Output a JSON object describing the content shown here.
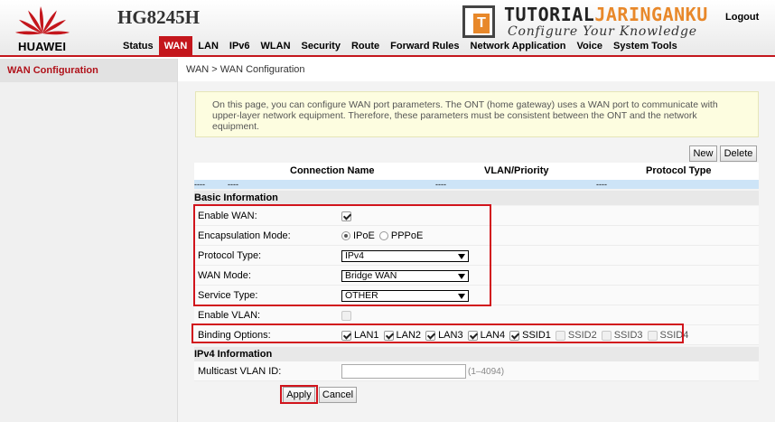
{
  "header": {
    "brand": "HUAWEI",
    "model": "HG8245H",
    "logout": "Logout",
    "watermark_title_a": "TUTORIAL",
    "watermark_title_b": "JARINGANKU",
    "watermark_sub": "Configure Your Knowledge",
    "brand_color": "#c4161c",
    "accent_color": "#e8882a"
  },
  "nav": {
    "items": [
      "Status",
      "WAN",
      "LAN",
      "IPv6",
      "WLAN",
      "Security",
      "Route",
      "Forward Rules",
      "Network Application",
      "Voice",
      "System Tools"
    ],
    "active": "WAN"
  },
  "sidebar": {
    "items": [
      "WAN Configuration"
    ]
  },
  "breadcrumb": "WAN > WAN Configuration",
  "notice": "On this page, you can configure WAN port parameters. The ONT (home gateway) uses a WAN port to communicate with upper-layer network equipment. Therefore, these parameters must be consistent between the ONT and the network equipment.",
  "toolbar": {
    "new_label": "New",
    "delete_label": "Delete"
  },
  "table": {
    "columns": [
      "Connection Name",
      "VLAN/Priority",
      "Protocol Type"
    ],
    "row": [
      "----",
      "----",
      "----",
      "----"
    ]
  },
  "basic": {
    "title": "Basic Information",
    "enable_wan_label": "Enable WAN:",
    "enable_wan": true,
    "encap_label": "Encapsulation Mode:",
    "encap_options": [
      "IPoE",
      "PPPoE"
    ],
    "encap_selected": "IPoE",
    "protocol_label": "Protocol Type:",
    "protocol_value": "IPv4",
    "wan_mode_label": "WAN Mode:",
    "wan_mode_value": "Bridge WAN",
    "service_label": "Service Type:",
    "service_value": "OTHER",
    "enable_vlan_label": "Enable VLAN:",
    "enable_vlan": false,
    "binding_label": "Binding Options:",
    "binding": [
      {
        "label": "LAN1",
        "checked": true
      },
      {
        "label": "LAN2",
        "checked": true
      },
      {
        "label": "LAN3",
        "checked": true
      },
      {
        "label": "LAN4",
        "checked": true
      },
      {
        "label": "SSID1",
        "checked": true
      },
      {
        "label": "SSID2",
        "checked": false
      },
      {
        "label": "SSID3",
        "checked": false
      },
      {
        "label": "SSID4",
        "checked": false
      }
    ]
  },
  "ipv4": {
    "title": "IPv4 Information",
    "multicast_label": "Multicast VLAN ID:",
    "multicast_value": "",
    "multicast_hint": "(1–4094)"
  },
  "actions": {
    "apply_label": "Apply",
    "cancel_label": "Cancel"
  }
}
